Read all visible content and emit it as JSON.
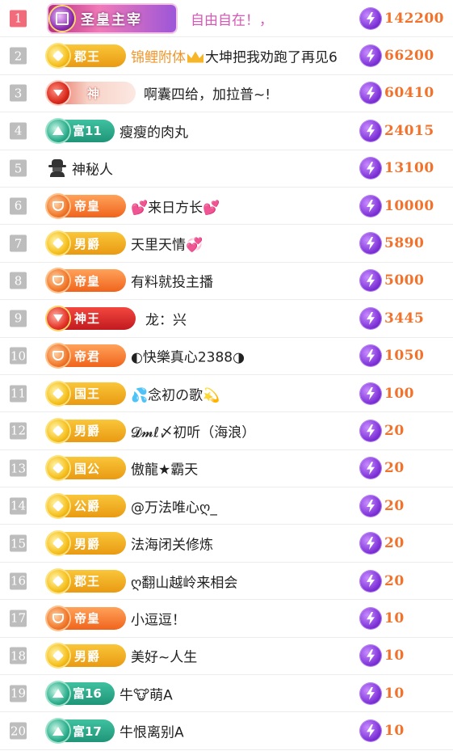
{
  "colors": {
    "score": "#f2722b",
    "rank_first": "#f26b7a",
    "rank_default": "#bdbdbd",
    "pink_name": "#d35ab5"
  },
  "score_icon": "lightning-bolt-icon",
  "rows": [
    {
      "rank": "1",
      "badge": "圣皇主宰",
      "badge_style": "imperial",
      "name": "自由自在！，",
      "score": "142200"
    },
    {
      "rank": "2",
      "badge": "郡王",
      "badge_style": "gold",
      "name_part1": "锦鲤附体",
      "name_part2": "大坤把我劝跑了再见6",
      "score": "66200"
    },
    {
      "rank": "3",
      "badge": "神",
      "badge_style": "shen",
      "name": "啊囊四给，加拉普~!",
      "score": "60410"
    },
    {
      "rank": "4",
      "badge": "富11",
      "badge_style": "teal",
      "name": "瘦瘦的肉丸",
      "score": "24015"
    },
    {
      "rank": "5",
      "badge_icon": "incognito-icon",
      "name": "神秘人",
      "score": "13100"
    },
    {
      "rank": "6",
      "badge": "帝皇",
      "badge_style": "orange",
      "name": "💕来日方长💕",
      "score": "10000"
    },
    {
      "rank": "7",
      "badge": "男爵",
      "badge_style": "gold",
      "name": "天里天情💞",
      "score": "5890"
    },
    {
      "rank": "8",
      "badge": "帝皇",
      "badge_style": "orange",
      "name": "有料就投主播",
      "score": "5000"
    },
    {
      "rank": "9",
      "badge": "神王",
      "badge_style": "red",
      "name": "龙：兴",
      "score": "3445"
    },
    {
      "rank": "10",
      "badge": "帝君",
      "badge_style": "orange",
      "name": "◐快樂真心2388◑",
      "score": "1050"
    },
    {
      "rank": "11",
      "badge": "国王",
      "badge_style": "gold",
      "name": "💦念初の歌💫",
      "score": "100"
    },
    {
      "rank": "12",
      "badge": "男爵",
      "badge_style": "gold",
      "name": "𝓓𝓶ℓ〆初听（海浪）",
      "score": "20"
    },
    {
      "rank": "13",
      "badge": "国公",
      "badge_style": "gold",
      "name": "傲龍★霸天",
      "score": "20"
    },
    {
      "rank": "14",
      "badge": "公爵",
      "badge_style": "gold",
      "name": "@万法唯心ღ_",
      "score": "20"
    },
    {
      "rank": "15",
      "badge": "男爵",
      "badge_style": "gold",
      "name": "法海闭关修炼",
      "score": "20"
    },
    {
      "rank": "16",
      "badge": "郡王",
      "badge_style": "gold",
      "name": "ღ翻山越岭来相会",
      "score": "20"
    },
    {
      "rank": "17",
      "badge": "帝皇",
      "badge_style": "orange",
      "name": "小逗逗！",
      "score": "10"
    },
    {
      "rank": "18",
      "badge": "男爵",
      "badge_style": "gold",
      "name": "美好~人生",
      "score": "10"
    },
    {
      "rank": "19",
      "badge": "富16",
      "badge_style": "teal",
      "name": "牛🐮萌A",
      "score": "10"
    },
    {
      "rank": "20",
      "badge": "富17",
      "badge_style": "teal",
      "name": "牛恨离别A",
      "score": "10"
    }
  ]
}
